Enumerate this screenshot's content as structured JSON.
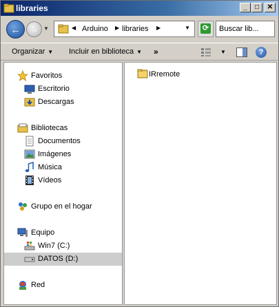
{
  "window": {
    "title": "libraries",
    "controls": {
      "minimize": "_",
      "maximize": "□",
      "close": "✕"
    }
  },
  "address": {
    "parts": [
      "Arduino",
      "libraries"
    ],
    "search_placeholder": "Buscar lib..."
  },
  "toolbar": {
    "organize": "Organizar",
    "include": "Incluir en biblioteca",
    "more": "»"
  },
  "nav": {
    "favorites": {
      "label": "Favoritos",
      "icon": "star-icon"
    },
    "desktop": {
      "label": "Escritorio",
      "icon": "desktop-icon"
    },
    "downloads": {
      "label": "Descargas",
      "icon": "downloads-folder-icon"
    },
    "libraries": {
      "label": "Bibliotecas",
      "icon": "libraries-icon"
    },
    "documents": {
      "label": "Documentos",
      "icon": "documents-icon"
    },
    "pictures": {
      "label": "Imágenes",
      "icon": "pictures-icon"
    },
    "music": {
      "label": "Música",
      "icon": "music-icon"
    },
    "videos": {
      "label": "Vídeos",
      "icon": "videos-icon"
    },
    "homegroup": {
      "label": "Grupo en el hogar",
      "icon": "homegroup-icon"
    },
    "computer": {
      "label": "Equipo",
      "icon": "computer-icon"
    },
    "drive_c": {
      "label": "Win7 (C:)",
      "icon": "windows-drive-icon"
    },
    "drive_d": {
      "label": "DATOS (D:)",
      "icon": "drive-icon"
    },
    "network": {
      "label": "Red",
      "icon": "network-icon"
    }
  },
  "files": [
    {
      "name": "IRremote",
      "icon": "folder-icon"
    }
  ],
  "colors": {
    "title_gradient_start": "#0a246a",
    "title_gradient_end": "#a6caf0",
    "chrome": "#d4d0c8",
    "selection": "#cdcdcd",
    "folder": "#e8c14a"
  }
}
